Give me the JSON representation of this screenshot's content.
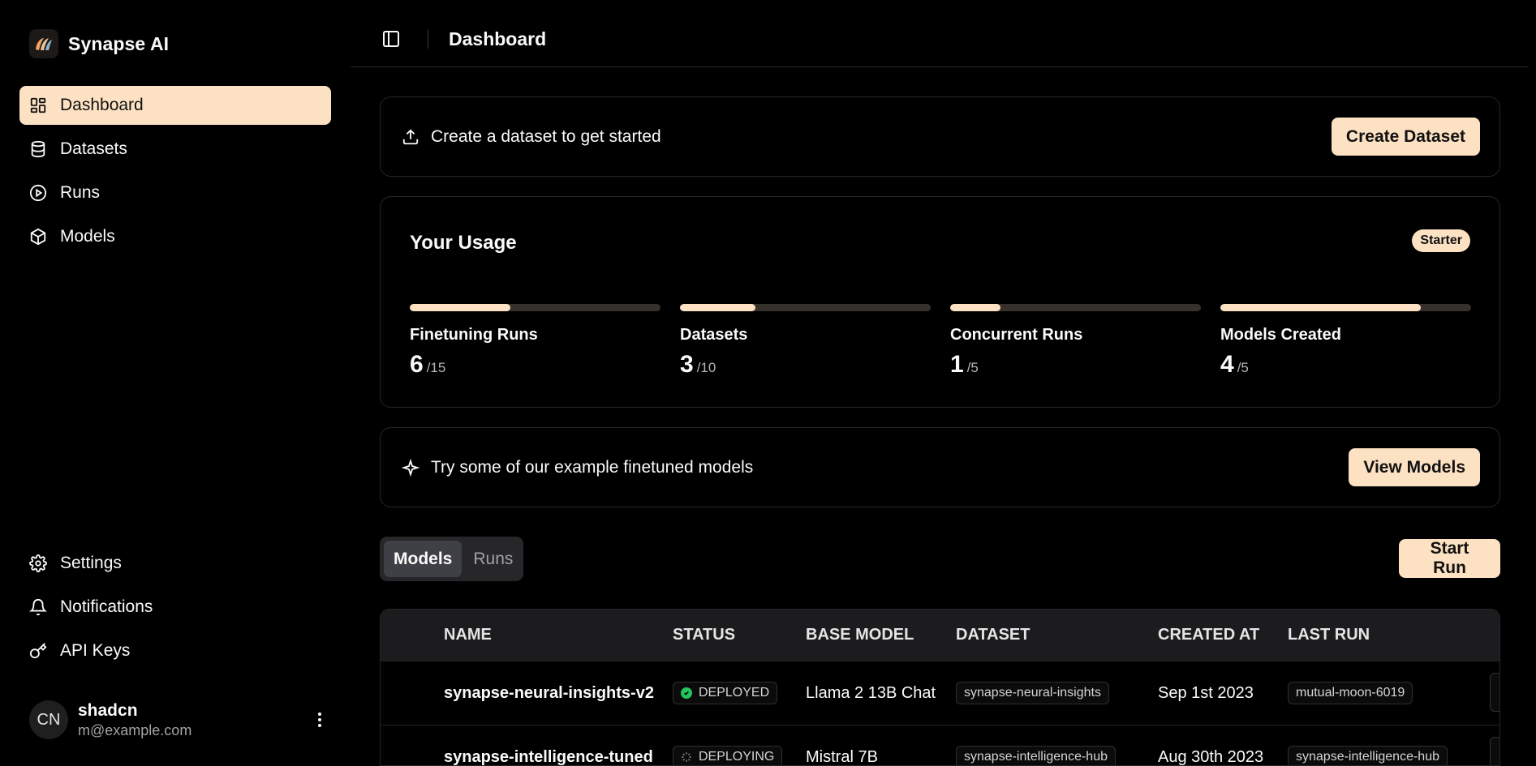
{
  "app": {
    "name": "Synapse AI"
  },
  "nav": {
    "items": [
      {
        "label": "Dashboard",
        "icon": "dashboard-icon",
        "active": true
      },
      {
        "label": "Datasets",
        "icon": "database-icon"
      },
      {
        "label": "Runs",
        "icon": "play-circle-icon"
      },
      {
        "label": "Models",
        "icon": "box-icon"
      }
    ],
    "bottom": [
      {
        "label": "Settings",
        "icon": "gear-icon"
      },
      {
        "label": "Notifications",
        "icon": "bell-icon"
      },
      {
        "label": "API Keys",
        "icon": "key-icon"
      }
    ]
  },
  "user": {
    "initials": "CN",
    "name": "shadcn",
    "email": "m@example.com"
  },
  "header": {
    "title": "Dashboard"
  },
  "dataset_card": {
    "text": "Create a dataset to get started",
    "button": "Create Dataset"
  },
  "usage": {
    "title": "Your Usage",
    "plan": "Starter",
    "items": [
      {
        "label": "Finetuning Runs",
        "value": "6",
        "max": "/15",
        "fraction": 0.4
      },
      {
        "label": "Datasets",
        "value": "3",
        "max": "/10",
        "fraction": 0.3
      },
      {
        "label": "Concurrent Runs",
        "value": "1",
        "max": "/5",
        "fraction": 0.2
      },
      {
        "label": "Models Created",
        "value": "4",
        "max": "/5",
        "fraction": 0.8
      }
    ]
  },
  "examples_card": {
    "text": "Try some of our example finetuned models",
    "button": "View Models"
  },
  "tabs": [
    {
      "label": "Models",
      "active": true
    },
    {
      "label": "Runs"
    }
  ],
  "start_run": "Start Run",
  "table": {
    "headers": [
      "NAME",
      "STATUS",
      "BASE MODEL",
      "DATASET",
      "CREATED AT",
      "LAST RUN"
    ],
    "rows": [
      {
        "name": "synapse-neural-insights-v2",
        "status": "DEPLOYED",
        "base_model": "Llama 2 13B Chat",
        "dataset": "synapse-neural-insights",
        "created_at": "Sep 1st 2023",
        "last_run": "mutual-moon-6019"
      },
      {
        "name": "synapse-intelligence-tuned",
        "status": "DEPLOYING",
        "base_model": "Mistral 7B",
        "dataset": "synapse-intelligence-hub",
        "created_at": "Aug 30th 2023",
        "last_run": "synapse-intelligence-hub"
      }
    ]
  },
  "colors": {
    "accent": "#fde1c3",
    "background": "#000000",
    "success": "#22c55e"
  }
}
